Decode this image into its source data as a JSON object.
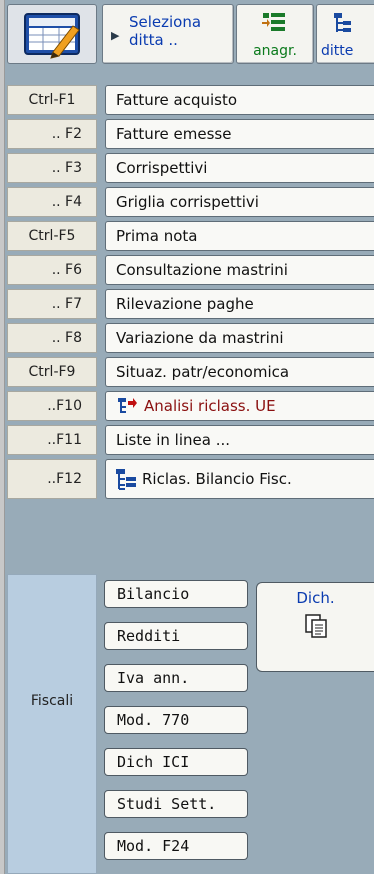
{
  "toolbar": {
    "select_company_label": "Seleziona ditta ..",
    "anagrafica_label": "anagr.",
    "ditte_label": "ditte"
  },
  "menu": [
    {
      "key": "Ctrl-F1",
      "label": "Fatture acquisto"
    },
    {
      "key": ".. F2",
      "label": "Fatture emesse"
    },
    {
      "key": ".. F3",
      "label": "Corrispettivi"
    },
    {
      "key": ".. F4",
      "label": "Griglia corrispettivi"
    },
    {
      "key": "Ctrl-F5",
      "label": "Prima nota"
    },
    {
      "key": ".. F6",
      "label": "Consultazione mastrini"
    },
    {
      "key": ".. F7",
      "label": "Rilevazione paghe"
    },
    {
      "key": ".. F8",
      "label": "Variazione da mastrini"
    },
    {
      "key": "Ctrl-F9",
      "label": "Situaz. patr/economica"
    },
    {
      "key": "..F10",
      "label": "Analisi riclass. UE"
    },
    {
      "key": "..F11",
      "label": "Liste in linea ..."
    },
    {
      "key": "..F12",
      "label": "Riclas. Bilancio Fisc."
    }
  ],
  "fiscali": {
    "section_label": "Fiscali",
    "buttons": [
      "Bilancio",
      "Redditi",
      "Iva ann.",
      "Mod. 770",
      "Dich ICI",
      "Studi Sett.",
      "Mod. F24"
    ],
    "dich_label": "Dich."
  },
  "colors": {
    "link_blue": "#0a3bb0",
    "green": "#0b7a1c",
    "dark_red": "#8a0f0f",
    "panel": "#98abb8",
    "fiscali_bg": "#b8cde0"
  }
}
